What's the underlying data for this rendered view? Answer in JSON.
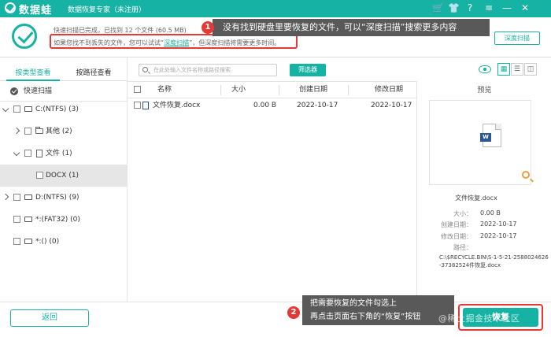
{
  "app": {
    "name": "数据蛙",
    "subtitle": "数据恢复专家（未注册）"
  },
  "titlebar_icons": [
    "cart-icon",
    "shirt-icon",
    "help-icon",
    "menu-icon",
    "minimize-icon",
    "close-icon"
  ],
  "status": {
    "line1": "快速扫描已完成，已找到 12 个文件 (60.5 MB)",
    "line2_pre": "如果您找不到丢失的文件，您可以试试“",
    "line2_link": "深度扫描",
    "line2_post": "”，但深度扫描将需要更多时间。",
    "deep_scan_button": "深度扫描"
  },
  "callout1": {
    "number": "1",
    "text": "没有找到硬盘里要恢复的文件，可以“深度扫描”搜索更多内容"
  },
  "callout2": {
    "number": "2",
    "line1": "把需要恢复的文件勾选上",
    "line2": "再点击页面右下角的“恢复”按钮"
  },
  "left_panel": {
    "tabs": [
      {
        "label": "按类型查看",
        "active": true
      },
      {
        "label": "按路径查看",
        "active": false
      }
    ],
    "quick_scan": "快速扫描",
    "tree": [
      {
        "label": "C:(NTFS) (3)"
      },
      {
        "label": "其他 (2)"
      },
      {
        "label": "文件 (1)"
      },
      {
        "label": "DOCX (1)"
      },
      {
        "label": "D:(NTFS) (9)"
      },
      {
        "label": "*:(FAT32) (0)"
      },
      {
        "label": "*:() (0)"
      }
    ]
  },
  "toolbar": {
    "search_placeholder": "在此处输入文件名称或路径搜索",
    "filter_button": "筛选器"
  },
  "table": {
    "headers": {
      "name": "名称",
      "size": "大小",
      "created": "创建日期",
      "modified": "修改日期"
    },
    "rows": [
      {
        "name": "文件恢复.docx",
        "size": "0.00  B",
        "created": "2022-10-17",
        "modified": "2022-10-17"
      }
    ]
  },
  "preview": {
    "title": "预览",
    "file_name": "文件恢复.docx",
    "size_label": "大小：",
    "size_value": "0.00  B",
    "created_label": "创建日期：",
    "created_value": "2022-10-17",
    "modified_label": "修改日期：",
    "modified_value": "2022-10-17",
    "path_label": "路径：",
    "path_value": "C:\\$RECYCLE.BIN\\S-1-5-21-2588024626-37382524件恢复.docx"
  },
  "bottom": {
    "back_button": "返回",
    "recover_button": "恢复"
  },
  "watermark": "@稀土掘金技术社区",
  "colors": {
    "accent": "#16b2a4",
    "highlight_red": "#e53935",
    "callout_bg": "#595959"
  }
}
